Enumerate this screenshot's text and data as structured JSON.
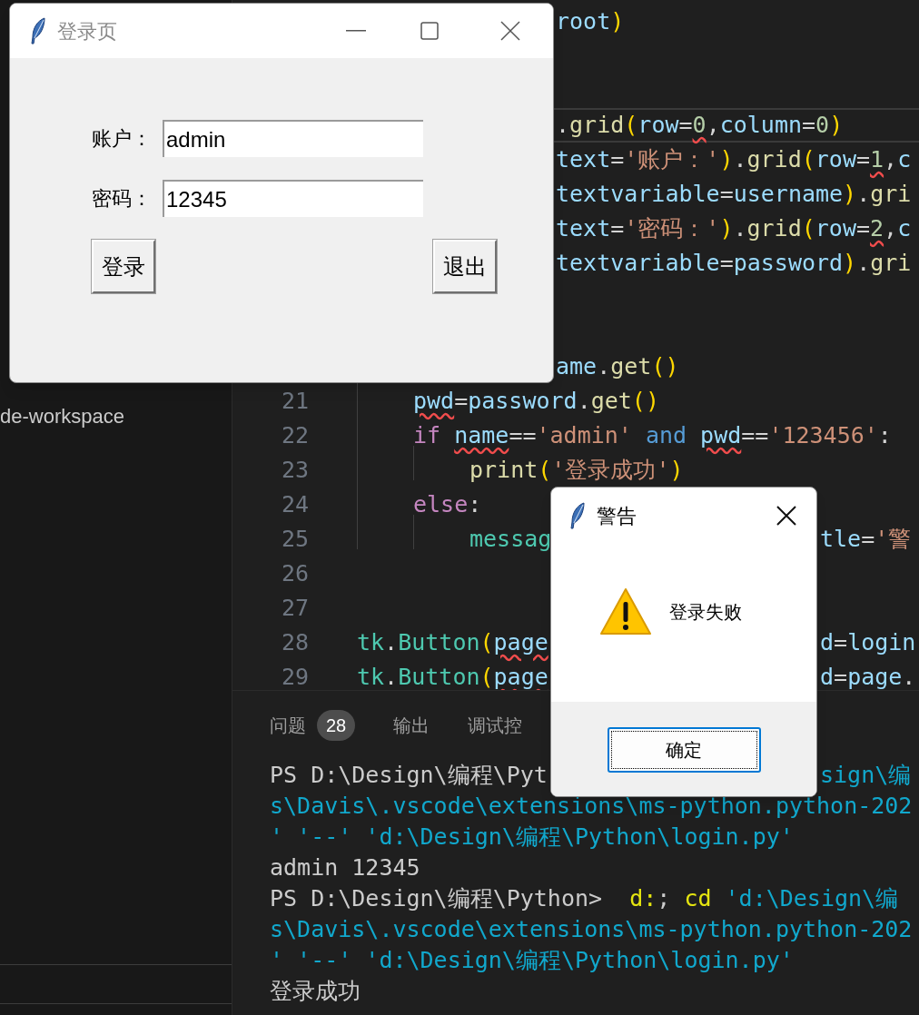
{
  "sidebar": {
    "items": [
      {
        "label": "de-workspace",
        "selected": false
      }
    ]
  },
  "editor": {
    "lines": [
      {
        "kind": "cut",
        "current": false,
        "parts": [
          [
            {
              "t": "root",
              "kind": "var"
            },
            {
              "t": ")",
              "kind": "br"
            }
          ]
        ]
      },
      {
        "kind": "cut",
        "current": false
      },
      {
        "kind": "cut",
        "current": false
      },
      {
        "kind": "cut",
        "current": true,
        "parts": [
          [
            {
              "t": ".",
              "kind": "op"
            },
            {
              "t": "grid",
              "kind": "func"
            },
            {
              "t": "(",
              "kind": "br"
            },
            {
              "t": "row",
              "kind": "var"
            },
            {
              "t": "=",
              "kind": "op"
            },
            {
              "t": "0",
              "kind": "num-err"
            },
            {
              "t": ",",
              "kind": "op"
            },
            {
              "t": "column",
              "kind": "var"
            },
            {
              "t": "=",
              "kind": "op"
            },
            {
              "t": "0",
              "kind": "num"
            },
            {
              "t": ")",
              "kind": "br"
            }
          ]
        ]
      },
      {
        "kind": "cut",
        "current": false,
        "parts": [
          [
            {
              "t": "text",
              "kind": "var"
            },
            {
              "t": "=",
              "kind": "op"
            },
            {
              "t": "'账户：'",
              "kind": "str"
            },
            {
              "t": ")",
              "kind": "br"
            },
            {
              "t": ".",
              "kind": "op"
            },
            {
              "t": "grid",
              "kind": "func"
            },
            {
              "t": "(",
              "kind": "br"
            },
            {
              "t": "row",
              "kind": "var"
            },
            {
              "t": "=",
              "kind": "op"
            },
            {
              "t": "1",
              "kind": "num-err"
            },
            {
              "t": ",",
              "kind": "op"
            },
            {
              "t": "c",
              "kind": "var"
            }
          ]
        ]
      },
      {
        "kind": "cut",
        "current": false,
        "parts": [
          [
            {
              "t": "textvariable",
              "kind": "var"
            },
            {
              "t": "=",
              "kind": "op"
            },
            {
              "t": "username",
              "kind": "var"
            },
            {
              "t": ")",
              "kind": "br"
            },
            {
              "t": ".",
              "kind": "op"
            },
            {
              "t": "gri",
              "kind": "func"
            }
          ]
        ]
      },
      {
        "kind": "cut",
        "current": false,
        "parts": [
          [
            {
              "t": "text",
              "kind": "var"
            },
            {
              "t": "=",
              "kind": "op"
            },
            {
              "t": "'密码：'",
              "kind": "str"
            },
            {
              "t": ")",
              "kind": "br"
            },
            {
              "t": ".",
              "kind": "op"
            },
            {
              "t": "grid",
              "kind": "func"
            },
            {
              "t": "(",
              "kind": "br"
            },
            {
              "t": "row",
              "kind": "var"
            },
            {
              "t": "=",
              "kind": "op"
            },
            {
              "t": "2",
              "kind": "num-err"
            },
            {
              "t": ",",
              "kind": "op"
            },
            {
              "t": "c",
              "kind": "var"
            }
          ]
        ]
      },
      {
        "kind": "cut",
        "current": false,
        "parts": [
          [
            {
              "t": "textvariable",
              "kind": "var"
            },
            {
              "t": "=",
              "kind": "op"
            },
            {
              "t": "password",
              "kind": "var"
            },
            {
              "t": ")",
              "kind": "br"
            },
            {
              "t": ".",
              "kind": "op"
            },
            {
              "t": "gri",
              "kind": "func"
            }
          ]
        ]
      },
      {
        "kind": "cut",
        "current": false
      },
      {
        "kind": "cut",
        "current": false
      },
      {
        "kind": "cut",
        "current": false,
        "parts": [
          [
            {
              "t": "ame",
              "kind": "var"
            },
            {
              "t": ".",
              "kind": "op"
            },
            {
              "t": "get",
              "kind": "func"
            },
            {
              "t": "()",
              "kind": "br"
            }
          ]
        ]
      },
      {
        "number": "21",
        "kind": "body",
        "current": false,
        "parts": [
          [
            {
              "t": "pwd",
              "kind": "var-err"
            },
            {
              "t": "=",
              "kind": "op"
            },
            {
              "t": "password",
              "kind": "var"
            },
            {
              "t": ".",
              "kind": "op"
            },
            {
              "t": "get",
              "kind": "func"
            },
            {
              "t": "()",
              "kind": "br"
            }
          ]
        ]
      },
      {
        "number": "22",
        "kind": "body",
        "current": false,
        "parts": [
          [
            {
              "t": "if ",
              "kind": "kw"
            },
            {
              "t": "name",
              "kind": "var-err"
            },
            {
              "t": "==",
              "kind": "op"
            },
            {
              "t": "'admin'",
              "kind": "str"
            },
            {
              "t": " and ",
              "kind": "bi"
            },
            {
              "t": "pwd",
              "kind": "var-err"
            },
            {
              "t": "==",
              "kind": "op"
            },
            {
              "t": "'123456'",
              "kind": "str"
            },
            {
              "t": ":",
              "kind": "op"
            }
          ]
        ]
      },
      {
        "number": "23",
        "kind": "block",
        "current": false,
        "parts": [
          [
            {
              "t": "print",
              "kind": "func"
            },
            {
              "t": "(",
              "kind": "br"
            },
            {
              "t": "'登录成功'",
              "kind": "str"
            },
            {
              "t": ")",
              "kind": "br"
            }
          ]
        ]
      },
      {
        "number": "24",
        "kind": "body",
        "current": false,
        "parts": [
          [
            {
              "t": "else",
              "kind": "kw"
            },
            {
              "t": ":",
              "kind": "op"
            }
          ]
        ]
      },
      {
        "number": "25",
        "kind": "block",
        "current": false,
        "parts": [
          [
            {
              "t": "messag",
              "kind": "cls"
            }
          ],
          [
            {
              "t": "tle",
              "kind": "var"
            },
            {
              "t": "=",
              "kind": "op"
            },
            {
              "t": "'警",
              "kind": "str"
            }
          ]
        ]
      },
      {
        "number": "26",
        "kind": "top",
        "current": false
      },
      {
        "number": "27",
        "kind": "top",
        "current": false
      },
      {
        "number": "28",
        "kind": "top",
        "current": false,
        "parts": [
          [
            {
              "t": "tk",
              "kind": "cls"
            },
            {
              "t": ".",
              "kind": "op"
            },
            {
              "t": "Button",
              "kind": "cls"
            },
            {
              "t": "(",
              "kind": "br"
            },
            {
              "t": "page",
              "kind": "var-err"
            }
          ],
          [
            {
              "t": "d",
              "kind": "var"
            },
            {
              "t": "=",
              "kind": "op"
            },
            {
              "t": "login",
              "kind": "var"
            }
          ]
        ]
      },
      {
        "number": "29",
        "kind": "top",
        "current": false,
        "parts": [
          [
            {
              "t": "tk",
              "kind": "cls"
            },
            {
              "t": ".",
              "kind": "op"
            },
            {
              "t": "Button",
              "kind": "cls"
            },
            {
              "t": "(",
              "kind": "br"
            },
            {
              "t": "page",
              "kind": "var-err"
            }
          ],
          [
            {
              "t": "d",
              "kind": "var"
            },
            {
              "t": "=",
              "kind": "op"
            },
            {
              "t": "page",
              "kind": "var"
            },
            {
              "t": ".",
              "kind": "op"
            }
          ]
        ]
      }
    ]
  },
  "panel": {
    "tabs": [
      {
        "label": "问题",
        "badge": "28",
        "selected": false
      },
      {
        "label": "输出",
        "selected": false
      },
      {
        "label": "调试控",
        "selected": false
      }
    ],
    "terminal": [
      {
        "parts": [
          [
            {
              "t": "PS D:\\Design\\编程\\Pyt",
              "kind": "txt"
            }
          ],
          [
            {
              "t": "sign\\编",
              "kind": "cyan"
            }
          ]
        ]
      },
      {
        "parts": [
          [
            {
              "t": "s\\Davis\\.vscode\\extensions\\ms-python.python-202",
              "kind": "cyan"
            }
          ]
        ]
      },
      {
        "parts": [
          [
            {
              "t": "' '--' 'd:\\Design\\编程\\Python\\login.py'",
              "kind": "cyan"
            }
          ]
        ]
      },
      {
        "parts": [
          [
            {
              "t": "admin 12345",
              "kind": "txt"
            }
          ]
        ]
      },
      {
        "parts": [
          [
            {
              "t": "PS D:\\Design\\编程\\Python>  ",
              "kind": "txt"
            },
            {
              "t": "d:",
              "kind": "yel"
            },
            {
              "t": "; ",
              "kind": "txt"
            },
            {
              "t": "cd",
              "kind": "yel"
            },
            {
              "t": " 'd:\\Design\\编",
              "kind": "cyan"
            }
          ]
        ]
      },
      {
        "parts": [
          [
            {
              "t": "s\\Davis\\.vscode\\extensions\\ms-python.python-202",
              "kind": "cyan"
            }
          ]
        ]
      },
      {
        "parts": [
          [
            {
              "t": "' '--' 'd:\\Design\\编程\\Python\\login.py'",
              "kind": "cyan"
            }
          ]
        ]
      },
      {
        "parts": [
          [
            {
              "t": "登录成功",
              "kind": "txt"
            }
          ]
        ]
      }
    ]
  },
  "login_window": {
    "title": "登录页",
    "active": false,
    "fields": [
      {
        "label": "账户：",
        "value": "admin"
      },
      {
        "label": "密码：",
        "value": "12345"
      }
    ],
    "buttons": [
      "登录",
      "退出"
    ]
  },
  "warning_dialog": {
    "title": "警告",
    "active": true,
    "message": "登录失败",
    "button": "确定"
  }
}
